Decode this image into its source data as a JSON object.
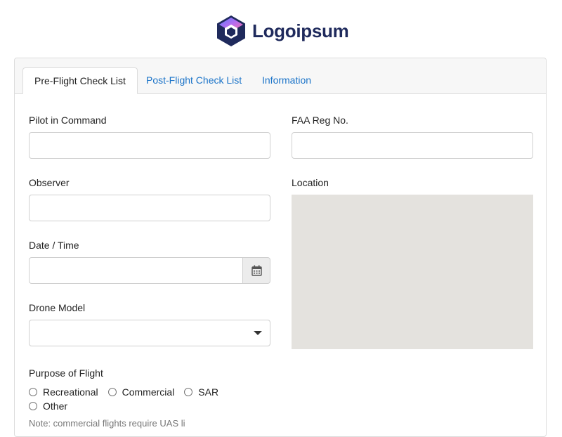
{
  "brand": {
    "name": "Logoipsum"
  },
  "tabs": [
    {
      "label": "Pre-Flight Check List",
      "active": true
    },
    {
      "label": "Post-Flight Check List",
      "active": false
    },
    {
      "label": "Information",
      "active": false
    }
  ],
  "form": {
    "pilot_label": "Pilot in Command",
    "pilot_value": "",
    "faa_label": "FAA Reg No.",
    "faa_value": "",
    "observer_label": "Observer",
    "observer_value": "",
    "location_label": "Location",
    "datetime_label": "Date / Time",
    "datetime_value": "",
    "drone_label": "Drone Model",
    "drone_value": "",
    "purpose_label": "Purpose of Flight",
    "purpose_options": [
      "Recreational",
      "Commercial",
      "SAR",
      "Other"
    ],
    "note": "Note: commercial flights require UAS li"
  },
  "colors": {
    "link": "#1a73c8",
    "brand_text": "#1f2a5c",
    "map_bg": "#e4e2de"
  }
}
